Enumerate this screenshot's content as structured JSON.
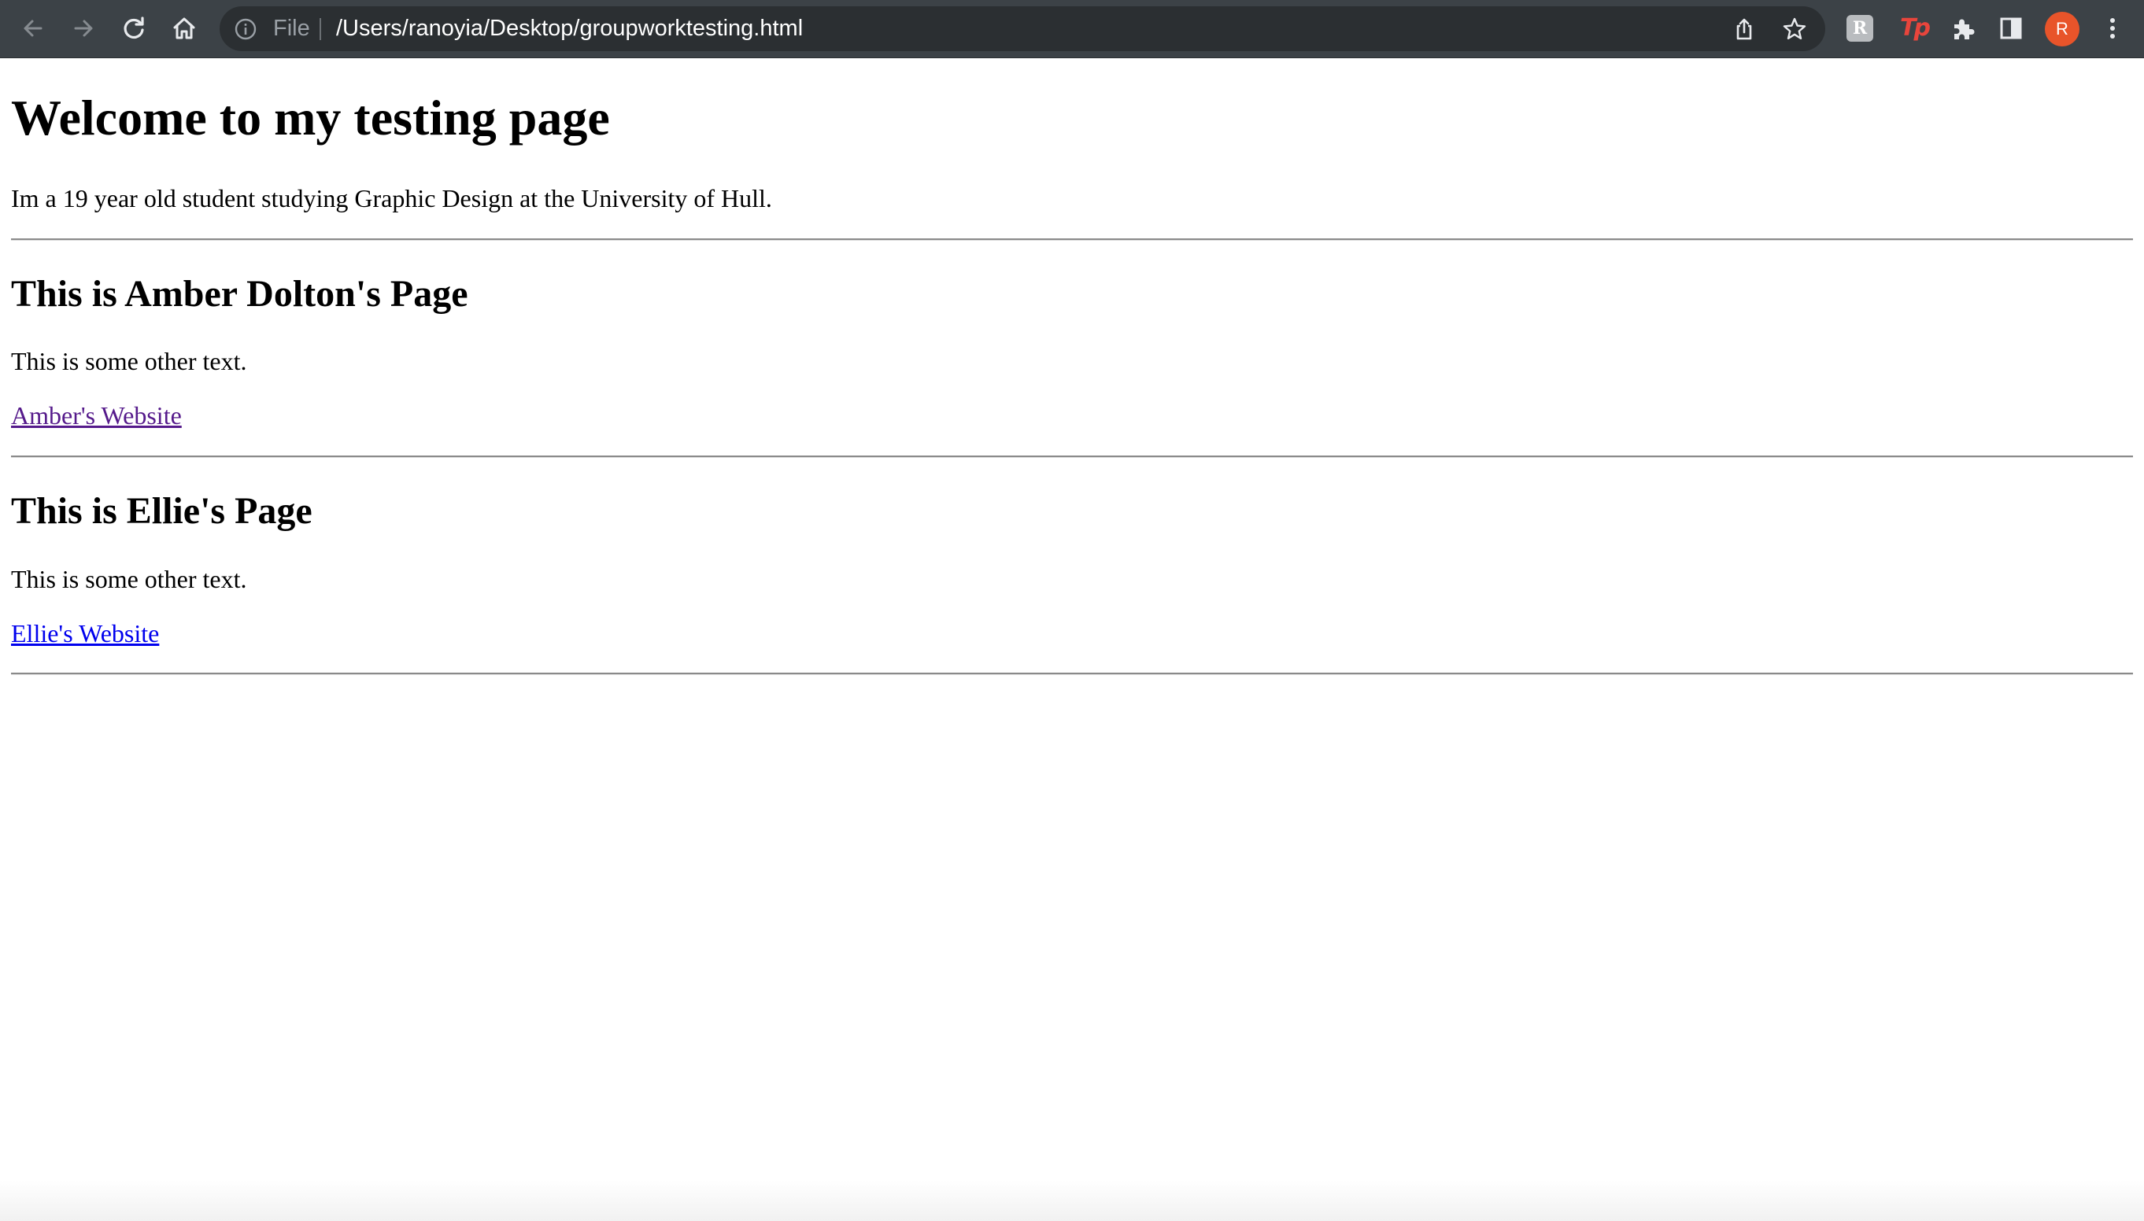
{
  "browser": {
    "address_scheme": "File",
    "url": "/Users/ranoyia/Desktop/groupworktesting.html",
    "profile_initial": "R",
    "extension_r_label": "R",
    "extension_tp_label": "Tp",
    "icons": [
      "back-arrow-icon",
      "forward-arrow-icon",
      "reload-icon",
      "home-icon",
      "info-icon",
      "share-icon",
      "bookmark-star-icon",
      "puzzle-extensions-icon",
      "side-panel-icon",
      "kebab-menu-icon"
    ],
    "colors": {
      "toolbar": "#3c4247",
      "omnibox": "#2b2f32",
      "avatar": "#e8542a",
      "extension_tp": "#e8453c"
    }
  },
  "page": {
    "title": "Welcome to my testing page",
    "intro": "Im a 19 year old student studying Graphic Design at the University of Hull.",
    "sections": [
      {
        "heading": "This is Amber Dolton's Page",
        "text": "This is some other text.",
        "link_label": "Amber's Website",
        "link_color": "#551a8b"
      },
      {
        "heading": "This is Ellie's Page",
        "text": "This is some other text.",
        "link_label": "Ellie's Website",
        "link_color": "#0000ee"
      }
    ]
  }
}
